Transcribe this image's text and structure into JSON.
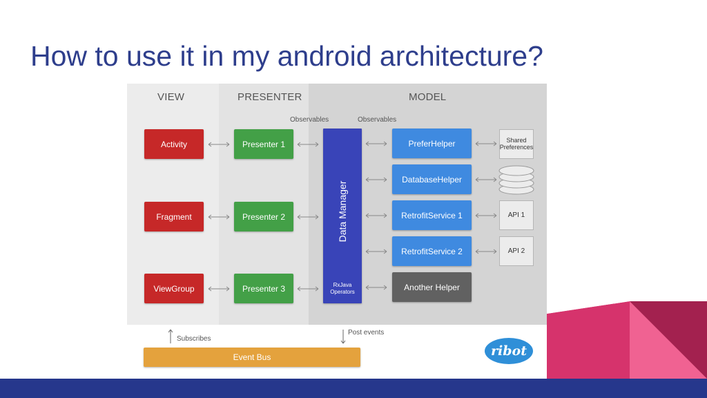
{
  "slide": {
    "title": "How to use it in my android architecture?"
  },
  "diagram": {
    "columns": {
      "view": "VIEW",
      "presenter": "PRESENTER",
      "model": "MODEL"
    },
    "observables_left": "Observables",
    "observables_right": "Observables",
    "view_items": [
      "Activity",
      "Fragment",
      "ViewGroup"
    ],
    "presenters": [
      "Presenter 1",
      "Presenter 2",
      "Presenter 3"
    ],
    "data_manager": {
      "label": "Data Manager",
      "sub1": "RxJava",
      "sub2": "Operators"
    },
    "helpers": [
      "PreferHelper",
      "DatabaseHelper",
      "RetrofitService 1",
      "RetrofitService 2",
      "Another Helper"
    ],
    "side_items": {
      "shared1": "Shared",
      "shared2": "Preferences",
      "api1": "API 1",
      "api2": "API 2"
    },
    "subscribes": "Subscribes",
    "post_events": "Post events",
    "event_bus": "Event Bus",
    "logo": "ribot",
    "colors": {
      "view": "#c62828",
      "presenter": "#43a047",
      "data_manager": "#3944b8",
      "helper": "#3f8ae0",
      "another_helper": "#616161",
      "event_bus": "#e4a23d"
    }
  },
  "decor": {
    "footer_color": "#26378c",
    "accent_pink": "#e64a7a",
    "accent_dark": "#a0214f"
  }
}
